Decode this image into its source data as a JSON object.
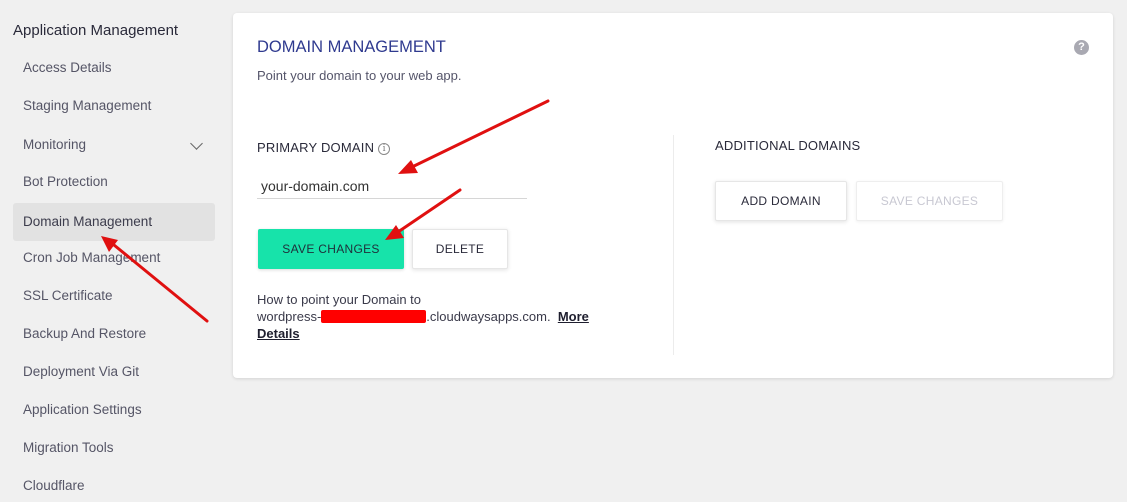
{
  "sidebar": {
    "heading": "Application Management",
    "items": [
      {
        "label": "Access Details"
      },
      {
        "label": "Staging Management"
      },
      {
        "label": "Monitoring"
      },
      {
        "label": "Bot Protection"
      },
      {
        "label": "Domain Management"
      },
      {
        "label": "Cron Job Management"
      },
      {
        "label": "SSL Certificate"
      },
      {
        "label": "Backup And Restore"
      },
      {
        "label": "Deployment Via Git"
      },
      {
        "label": "Application Settings"
      },
      {
        "label": "Migration Tools"
      },
      {
        "label": "Cloudflare"
      }
    ]
  },
  "card": {
    "title": "DOMAIN MANAGEMENT",
    "subtitle": "Point your domain to your web app.",
    "help_icon": "?"
  },
  "primary": {
    "label": "PRIMARY DOMAIN",
    "info_icon": "i",
    "domain_value": "your-domain.com",
    "save_label": "SAVE CHANGES",
    "delete_label": "DELETE",
    "help_prefix": "How to point your Domain to",
    "help_host_start": "wordpress-",
    "help_host_end": ".cloudwaysapps.com.",
    "more_details": "More Details"
  },
  "additional": {
    "label": "ADDITIONAL DOMAINS",
    "add_label": "ADD DOMAIN",
    "save_label": "SAVE CHANGES"
  },
  "colors": {
    "accent": "#17e3aa",
    "title": "#2f3a8f",
    "annotation_arrow": "#e01010",
    "redaction": "#ff0000"
  }
}
